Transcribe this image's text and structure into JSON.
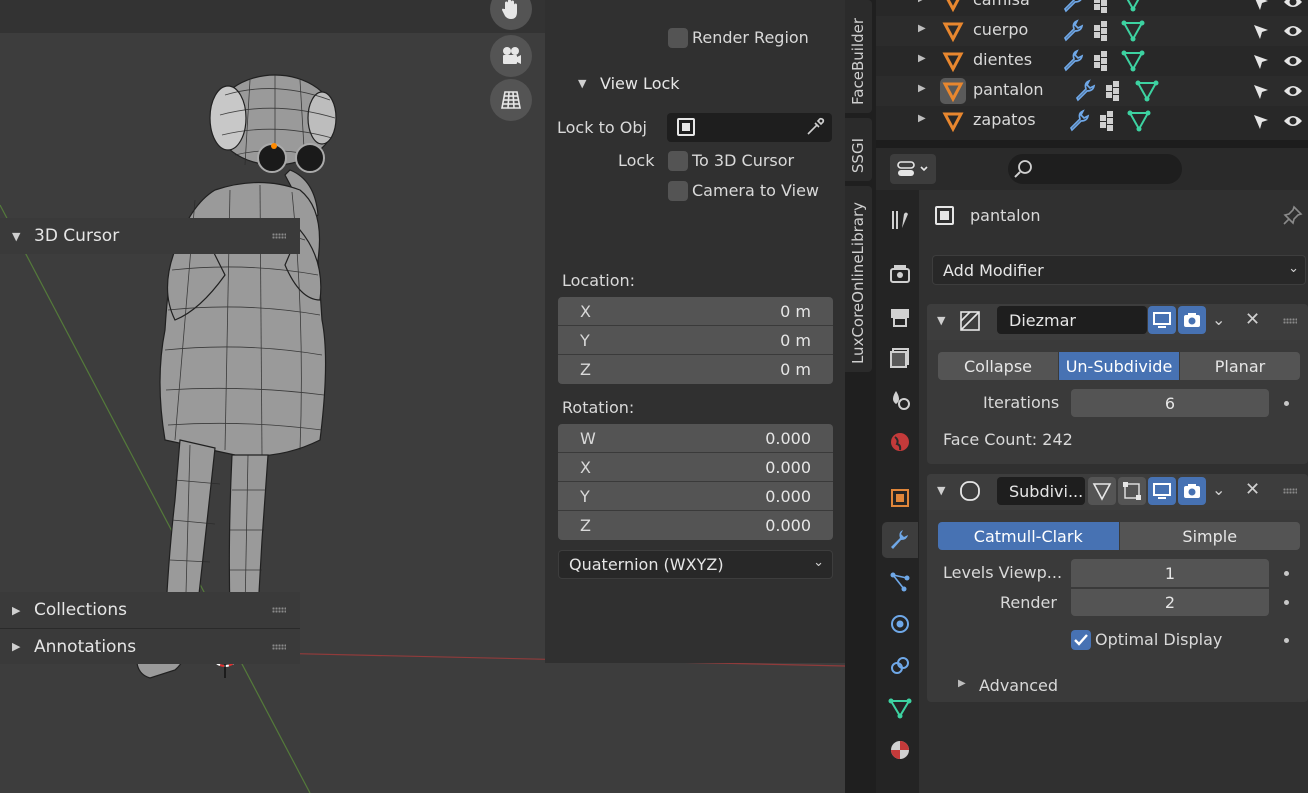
{
  "viewport": {
    "nav_icons": [
      "hand-pan-icon",
      "camera-view-icon",
      "ortho-grid-icon"
    ]
  },
  "npanel": {
    "render_region_label": "Render Region",
    "view_lock": {
      "title": "View Lock",
      "lock_to_obj_label": "Lock to Obj",
      "lock_label": "Lock",
      "to_3d_cursor_label": "To 3D Cursor",
      "camera_to_view_label": "Camera to View"
    },
    "cursor": {
      "title": "3D Cursor",
      "location_label": "Location:",
      "location": [
        {
          "axis": "X",
          "value": "0 m"
        },
        {
          "axis": "Y",
          "value": "0 m"
        },
        {
          "axis": "Z",
          "value": "0 m"
        }
      ],
      "rotation_label": "Rotation:",
      "rotation": [
        {
          "axis": "W",
          "value": "0.000"
        },
        {
          "axis": "X",
          "value": "0.000"
        },
        {
          "axis": "Y",
          "value": "0.000"
        },
        {
          "axis": "Z",
          "value": "0.000"
        }
      ],
      "rotation_mode": "Quaternion (WXYZ)"
    },
    "collections_title": "Collections",
    "annotations_title": "Annotations"
  },
  "vertical_tabs": [
    "FaceBuilder",
    "SSGI",
    "LuxCoreOnlineLibrary"
  ],
  "outliner": {
    "items": [
      {
        "name": "camisa"
      },
      {
        "name": "cuerpo"
      },
      {
        "name": "dientes"
      },
      {
        "name": "pantalon"
      },
      {
        "name": "zapatos"
      }
    ]
  },
  "properties": {
    "object_name": "pantalon",
    "add_modifier_label": "Add Modifier",
    "decimate": {
      "name": "Diezmar",
      "modes": [
        "Collapse",
        "Un-Subdivide",
        "Planar"
      ],
      "active_mode": "Un-Subdivide",
      "iterations_label": "Iterations",
      "iterations_value": "6",
      "face_count": "Face Count: 242"
    },
    "subsurf": {
      "name": "Subdivi...",
      "types": [
        "Catmull-Clark",
        "Simple"
      ],
      "active_type": "Catmull-Clark",
      "levels_viewport_label": "Levels Viewp...",
      "levels_viewport_value": "1",
      "render_label": "Render",
      "render_value": "2",
      "optimal_display_label": "Optimal Display",
      "optimal_display_checked": true,
      "advanced_label": "Advanced"
    }
  },
  "colors": {
    "accent_blue": "#4772b3",
    "mesh_orange": "#e8872f",
    "vertex_green": "#3dd2a1",
    "object_orange": "#e0863a"
  }
}
